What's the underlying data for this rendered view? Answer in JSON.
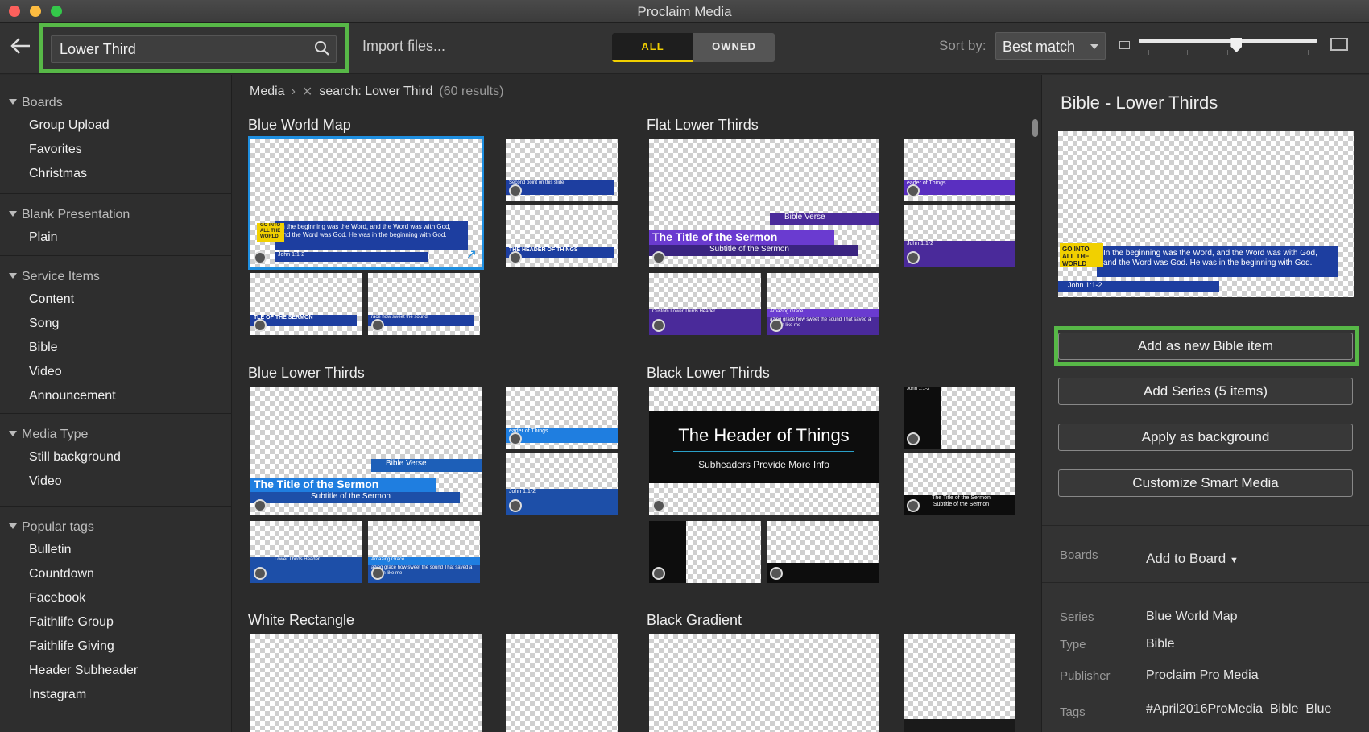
{
  "window": {
    "title": "Proclaim Media"
  },
  "toolbar": {
    "search_value": "Lower Third",
    "import_label": "Import files...",
    "filter_all": "ALL",
    "filter_owned": "OWNED",
    "sort_label": "Sort by:",
    "sort_value": "Best match",
    "zoom_slider_level": 0.55
  },
  "sidebar": {
    "sections": [
      {
        "title": "Boards",
        "items": [
          "Group Upload",
          "Favorites",
          "Christmas"
        ]
      },
      {
        "title": "Blank Presentation",
        "items": [
          "Plain"
        ]
      },
      {
        "title": "Service Items",
        "items": [
          "Content",
          "Song",
          "Bible",
          "Video",
          "Announcement"
        ]
      },
      {
        "title": "Media Type",
        "items": [
          "Still background",
          "Video"
        ]
      },
      {
        "title": "Popular tags",
        "items": [
          "Bulletin",
          "Countdown",
          "Facebook",
          "Faithlife Group",
          "Faithlife Giving",
          "Header Subheader",
          "Instagram"
        ]
      }
    ]
  },
  "breadcrumb": {
    "root": "Media",
    "query": "search: Lower Third",
    "count": "(60 results)"
  },
  "groups": [
    {
      "title": "Blue World Map"
    },
    {
      "title": "Flat Lower Thirds"
    },
    {
      "title": "Blue Lower Thirds"
    },
    {
      "title": "Black Lower Thirds"
    },
    {
      "title": "White Rectangle"
    },
    {
      "title": "Black Gradient"
    }
  ],
  "thumb_text": {
    "bwm_main": "In the beginning was the Word, and the Word was with God, and the Word was God. He was in the beginning with God.",
    "bwm_tag": "GO INTO ALL THE WORLD",
    "bwm_ref": "John 1:1-2",
    "bwm_b1": "Second point on this slide",
    "bwm_b2": "THE HEADER OF THINGS",
    "bwm_b3": "TLE OF THE SERMON",
    "bwm_b4": "race how sweet the sound",
    "flt_verse": "Bible Verse",
    "flt_title": "The Title of the Sermon",
    "flt_sub": "Subtitle of the Sermon",
    "flt_r1": "eader of Things",
    "flt_r2": "John 1:1-2",
    "flt_b1": "Custom Lower Thirds Header",
    "flt_b2": "Amazing Grace",
    "flt_b2s": "azing grace how sweet the sound That saved a wretch like me",
    "blt_verse": "Bible Verse",
    "blt_title": "The Title of the Sermon",
    "blt_sub": "Subtitle of the Sermon",
    "blt_r1": "eader of Things",
    "blt_r2": "John 1:1-2",
    "blt_b1": "Lower Thirds Header",
    "blt_b2": "Amazing Grace",
    "blt_b2s": "azing grace how sweet the sound That saved a wretch like me",
    "blk_head": "The Header of Things",
    "blk_sub": "Subheaders Provide More Info",
    "blk_r1": "John 1:1-2",
    "blk_r2": "The Title of the Sermon",
    "blk_r2s": "Subtitle of the Sermon"
  },
  "panel": {
    "title": "Bible - Lower Thirds",
    "buttons": {
      "add_bible": "Add as new Bible item",
      "add_series": "Add Series (5 items)",
      "apply_bg": "Apply as background",
      "customize": "Customize Smart Media"
    },
    "boards_label": "Boards",
    "add_to_board": "Add to Board",
    "meta": [
      {
        "k": "Series",
        "v": "Blue World Map"
      },
      {
        "k": "Type",
        "v": "Bible"
      },
      {
        "k": "Publisher",
        "v": "Proclaim Pro Media"
      },
      {
        "k": "Tags",
        "v": "#April2016ProMedia  Bible  Blue"
      }
    ]
  },
  "colors": {
    "accent_yellow": "#f1d000",
    "highlight_green": "#57b847",
    "select_blue": "#1f8fe0"
  }
}
